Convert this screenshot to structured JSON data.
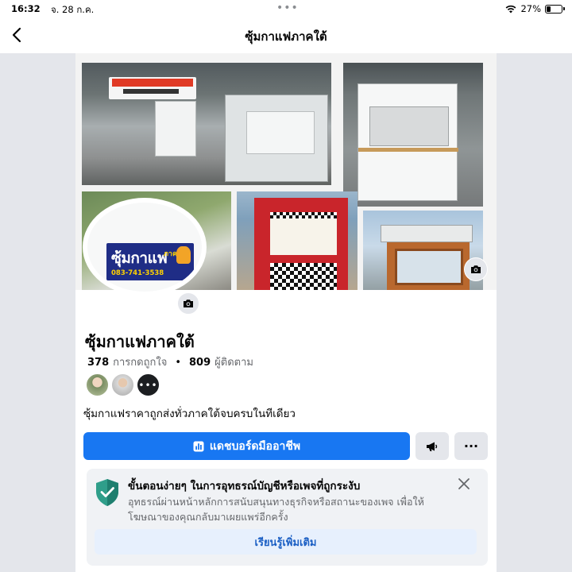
{
  "status_bar": {
    "time": "16:32",
    "date": "จ. 28 ก.ค.",
    "battery": "27%",
    "battery_level": 0.27,
    "icons": [
      "wifi-icon",
      "battery-icon"
    ]
  },
  "nav": {
    "title": "ซุ้มกาแฟภาคใต้",
    "back_icon": "chevron-left-icon"
  },
  "cover": {
    "photo_count": 5,
    "camera_icon": "camera-icon"
  },
  "avatar": {
    "logo_title": "ซุ้มกาแฟ",
    "logo_tag": "ภาคใต้",
    "logo_phone": "083-741-3538",
    "camera_icon": "camera-icon"
  },
  "profile": {
    "name": "ซุ้มกาแฟภาคใต้",
    "likes_count": "378",
    "likes_label": "การกดถูกใจ",
    "separator": "•",
    "followers_count": "809",
    "followers_label": "ผู้ติดตาม",
    "friends_more": "•••",
    "bio": "ซุ้มกาแฟราคาถูกส่งทั่วภาคใต้จบครบในทีเดียว"
  },
  "actions": {
    "dashboard_label": "แดชบอร์ดมืออาชีพ",
    "dashboard_icon": "bar-chart-icon",
    "announce_icon": "megaphone-icon",
    "more_label": "···"
  },
  "notice": {
    "title": "ขั้นตอนง่ายๆ ในการอุทธรณ์บัญชีหรือเพจที่ถูกระงับ",
    "body": "อุทธรณ์ผ่านหน้าหลักการสนับสนุนทางธุรกิจหรือสถานะของเพจ เพื่อให้โฆษณาของคุณกลับมาเผยแพร่อีกครั้ง",
    "button_label": "เรียนรู้เพิ่มเติม",
    "icon": "shield-icon",
    "close_icon": "close-icon"
  },
  "colors": {
    "primary": "#1877f2",
    "background": "#e4e6eb",
    "text_secondary": "#65676b",
    "notice_bg": "#f0f2f5",
    "learn_more_bg": "#e7f0fd"
  }
}
